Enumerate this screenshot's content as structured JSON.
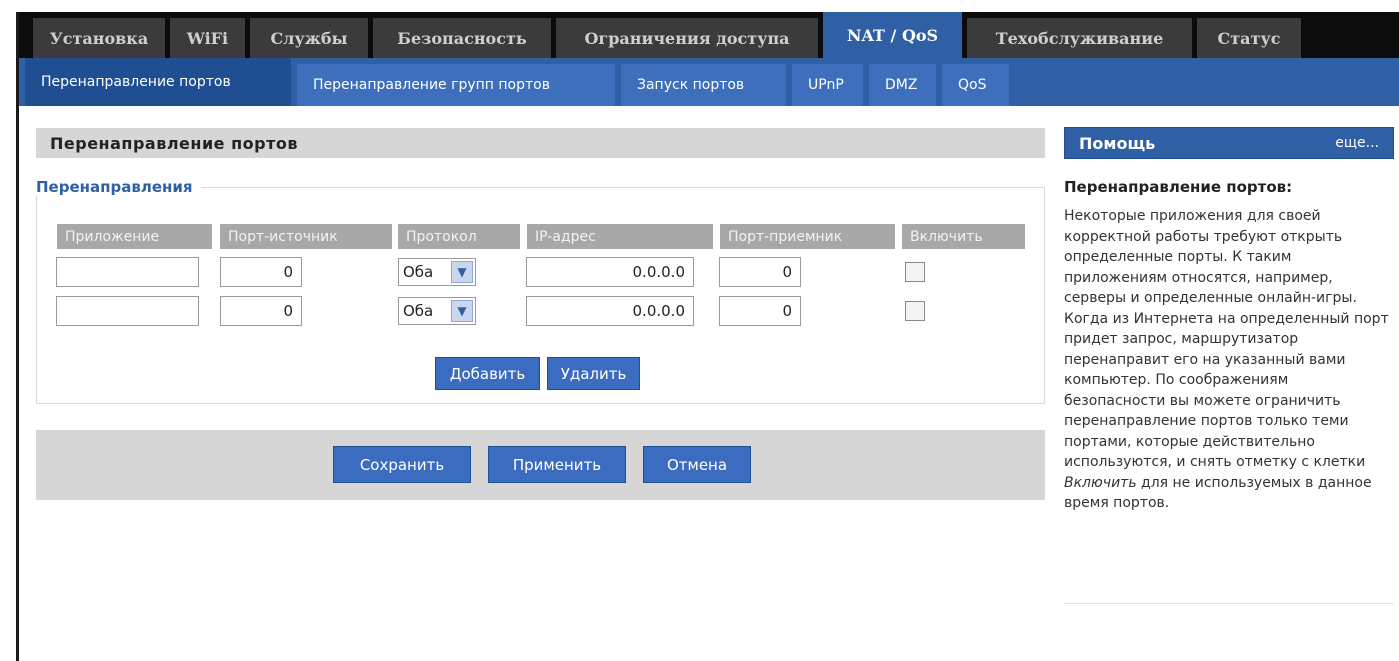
{
  "nav": {
    "tabs": [
      {
        "label": "Установка",
        "active": false
      },
      {
        "label": "WiFi",
        "active": false
      },
      {
        "label": "Службы",
        "active": false
      },
      {
        "label": "Безопасность",
        "active": false
      },
      {
        "label": "Ограничения доступа",
        "active": false
      },
      {
        "label": "NAT / QoS",
        "active": true
      },
      {
        "label": "Техобслуживание",
        "active": false
      },
      {
        "label": "Статус",
        "active": false
      }
    ],
    "subtabs": [
      {
        "label": "Перенаправление портов",
        "active": true
      },
      {
        "label": "Перенаправление групп портов",
        "active": false
      },
      {
        "label": "Запуск портов",
        "active": false
      },
      {
        "label": "UPnP",
        "active": false
      },
      {
        "label": "DMZ",
        "active": false
      },
      {
        "label": "QoS",
        "active": false
      }
    ]
  },
  "section": {
    "title": "Перенаправление портов",
    "legend": "Перенаправления"
  },
  "table": {
    "headers": [
      "Приложение",
      "Порт-источник",
      "Протокол",
      "IP-адрес",
      "Порт-приемник",
      "Включить"
    ],
    "rows": [
      {
        "app": "",
        "src_port": "0",
        "protocol": "Оба",
        "ip": "0.0.0.0",
        "dst_port": "0",
        "enabled": false
      },
      {
        "app": "",
        "src_port": "0",
        "protocol": "Оба",
        "ip": "0.0.0.0",
        "dst_port": "0",
        "enabled": false
      }
    ],
    "add_label": "Добавить",
    "remove_label": "Удалить"
  },
  "actions": {
    "save": "Сохранить",
    "apply": "Применить",
    "cancel": "Отмена"
  },
  "help": {
    "title": "Помощь",
    "more": "еще...",
    "subtitle": "Перенаправление портов:",
    "text_before": "Некоторые приложения для своей корректной работы требуют открыть определенные порты. К таким приложениям относятся, например, серверы и определенные онлайн-игры. Когда из Интернета на определенный порт придет запрос, маршрутизатор перенаправит его на указанный вами компьютер. По соображениям безопасности вы можете ограничить перенаправление портов только теми портами, которые действительно используются, и снять отметку с клетки ",
    "text_em": "Включить",
    "text_after": " для не используемых в данное время портов."
  },
  "colors": {
    "accent": "#2f5fa5",
    "button": "#3c6cc0",
    "tab_dark": "#3b3b3b",
    "panel_gray": "#d6d6d6"
  }
}
